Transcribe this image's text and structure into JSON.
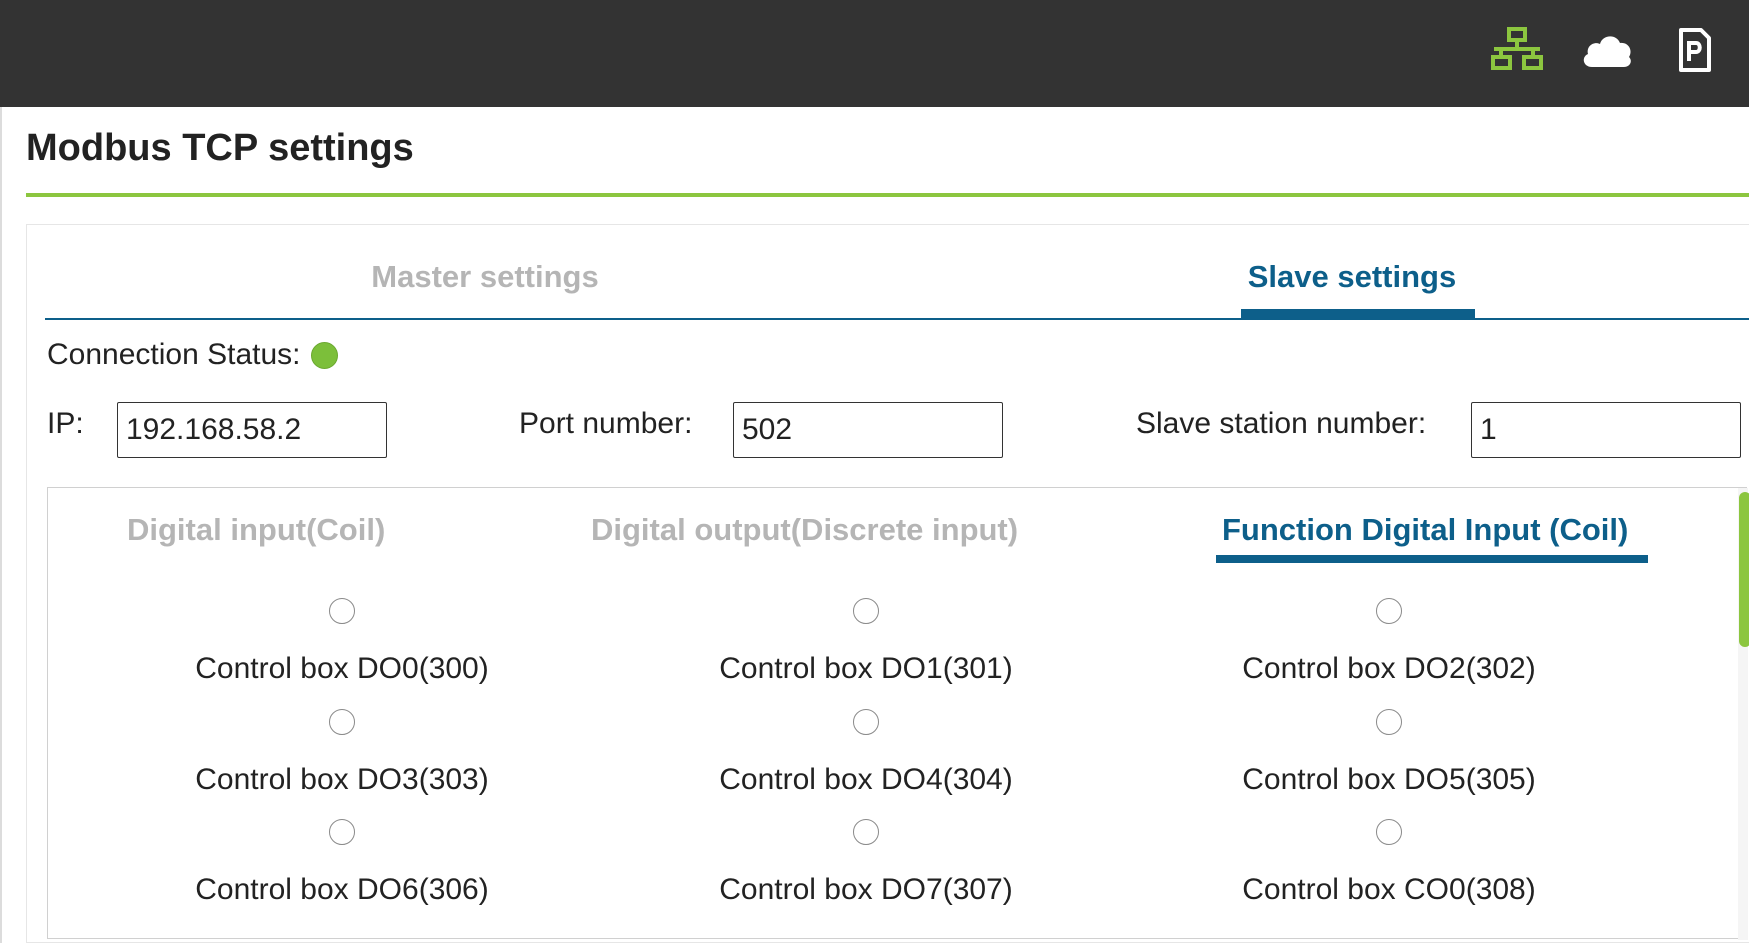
{
  "topbar": {
    "icons": [
      "network-icon",
      "cloud-icon",
      "document-p-icon"
    ],
    "colors": {
      "network_icon": "#8cc63f",
      "background": "#333333"
    }
  },
  "page": {
    "title": "Modbus TCP settings",
    "accent_color": "#8cc63f",
    "primary_color": "#0d5f8a"
  },
  "tabs": {
    "master_label": "Master settings",
    "slave_label": "Slave settings",
    "active": "Slave settings"
  },
  "connection": {
    "label": "Connection Status:",
    "status_color": "#7cbf3a"
  },
  "fields": {
    "ip_label": "IP:",
    "ip_value": "192.168.58.2",
    "port_label": "Port number:",
    "port_value": "502",
    "slave_label": "Slave station number:",
    "slave_value": "1"
  },
  "subtabs": {
    "digital_input": "Digital input(Coil)",
    "digital_output": "Digital output(Discrete input)",
    "function_digital_input": "Function Digital Input (Coil)",
    "active": "Function Digital Input (Coil)"
  },
  "options": [
    {
      "label": "Control box DO0(300)",
      "checked": false
    },
    {
      "label": "Control box DO1(301)",
      "checked": false
    },
    {
      "label": "Control box DO2(302)",
      "checked": false
    },
    {
      "label": "Control box DO3(303)",
      "checked": false
    },
    {
      "label": "Control box DO4(304)",
      "checked": false
    },
    {
      "label": "Control box DO5(305)",
      "checked": false
    },
    {
      "label": "Control box DO6(306)",
      "checked": false
    },
    {
      "label": "Control box DO7(307)",
      "checked": false
    },
    {
      "label": "Control box CO0(308)",
      "checked": false
    }
  ]
}
